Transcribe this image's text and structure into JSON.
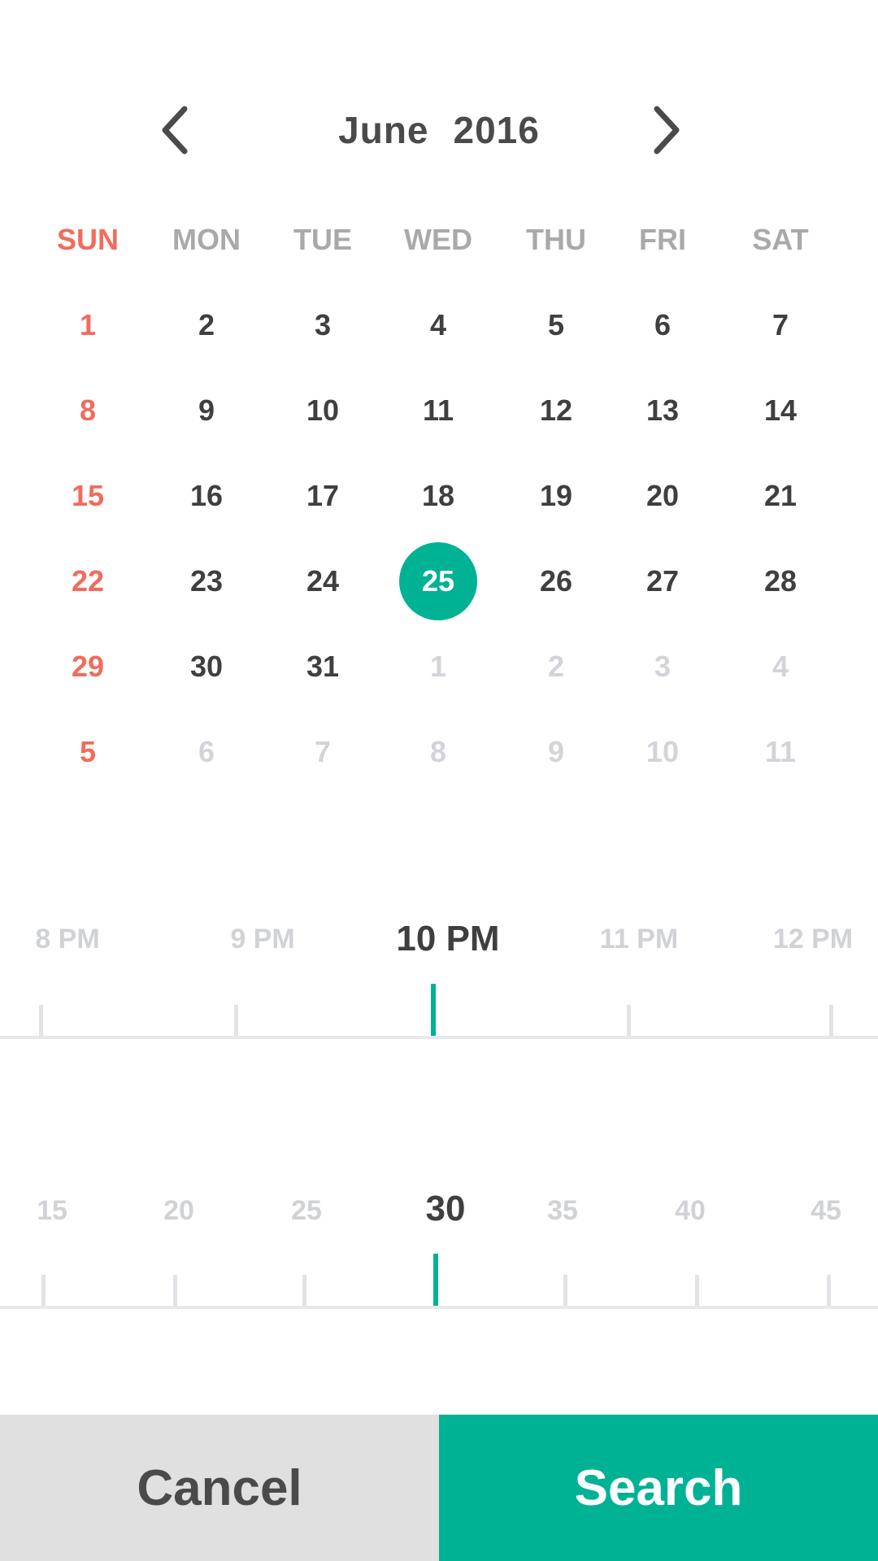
{
  "colors": {
    "accent": "#00b294",
    "sunday": "#f26b5b",
    "text": "#3f3f3f",
    "muted": "#d2d4d9",
    "cancel_bg": "#e0e0e1"
  },
  "header": {
    "prev_icon": "chevron-left-icon",
    "next_icon": "chevron-right-icon",
    "month": "June",
    "year": "2016"
  },
  "weekdays": [
    "SUN",
    "MON",
    "TUE",
    "WED",
    "THU",
    "FRI",
    "SAT"
  ],
  "calendar": {
    "weeks": [
      [
        {
          "d": "1",
          "s": "sun"
        },
        {
          "d": "2"
        },
        {
          "d": "3"
        },
        {
          "d": "4"
        },
        {
          "d": "5"
        },
        {
          "d": "6"
        },
        {
          "d": "7"
        }
      ],
      [
        {
          "d": "8",
          "s": "sun"
        },
        {
          "d": "9"
        },
        {
          "d": "10"
        },
        {
          "d": "11"
        },
        {
          "d": "12"
        },
        {
          "d": "13"
        },
        {
          "d": "14"
        }
      ],
      [
        {
          "d": "15",
          "s": "sun"
        },
        {
          "d": "16"
        },
        {
          "d": "17"
        },
        {
          "d": "18"
        },
        {
          "d": "19"
        },
        {
          "d": "20"
        },
        {
          "d": "21"
        }
      ],
      [
        {
          "d": "22",
          "s": "sun"
        },
        {
          "d": "23"
        },
        {
          "d": "24"
        },
        {
          "d": "25",
          "s": "selected"
        },
        {
          "d": "26"
        },
        {
          "d": "27"
        },
        {
          "d": "28"
        }
      ],
      [
        {
          "d": "29",
          "s": "sun"
        },
        {
          "d": "30"
        },
        {
          "d": "31"
        },
        {
          "d": "1",
          "s": "muted"
        },
        {
          "d": "2",
          "s": "muted"
        },
        {
          "d": "3",
          "s": "muted"
        },
        {
          "d": "4",
          "s": "muted"
        }
      ],
      [
        {
          "d": "5",
          "s": "sun"
        },
        {
          "d": "6",
          "s": "muted"
        },
        {
          "d": "7",
          "s": "muted"
        },
        {
          "d": "8",
          "s": "muted"
        },
        {
          "d": "9",
          "s": "muted"
        },
        {
          "d": "10",
          "s": "muted"
        },
        {
          "d": "11",
          "s": "muted"
        }
      ]
    ],
    "selected_day": "25"
  },
  "hour_picker": {
    "labels": [
      "8 PM",
      "9 PM",
      "10 PM",
      "11 PM",
      "12 PM"
    ],
    "selected": "10 PM"
  },
  "minute_picker": {
    "labels": [
      "15",
      "20",
      "25",
      "30",
      "35",
      "40",
      "45"
    ],
    "selected": "30"
  },
  "actions": {
    "cancel_label": "Cancel",
    "search_label": "Search"
  }
}
